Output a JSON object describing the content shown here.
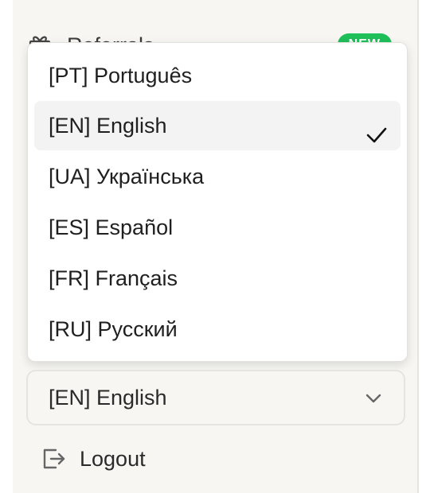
{
  "sidebar": {
    "referrals": {
      "label": "Referrals",
      "icon": "gift-icon",
      "badge": "NEW",
      "badge_color": "#1fbf5a"
    },
    "language_menu": {
      "items": [
        {
          "label": "[PT] Português",
          "selected": false
        },
        {
          "label": "[EN] English",
          "selected": true
        },
        {
          "label": "[UA] Українська",
          "selected": false
        },
        {
          "label": "[ES] Español",
          "selected": false
        },
        {
          "label": "[FR] Français",
          "selected": false
        },
        {
          "label": "[RU] Русский",
          "selected": false
        }
      ],
      "check_icon": "check-icon"
    },
    "language_select": {
      "value": "[EN] English",
      "icon": "chevron-down-icon"
    },
    "logout": {
      "label": "Logout",
      "icon": "logout-icon"
    }
  }
}
